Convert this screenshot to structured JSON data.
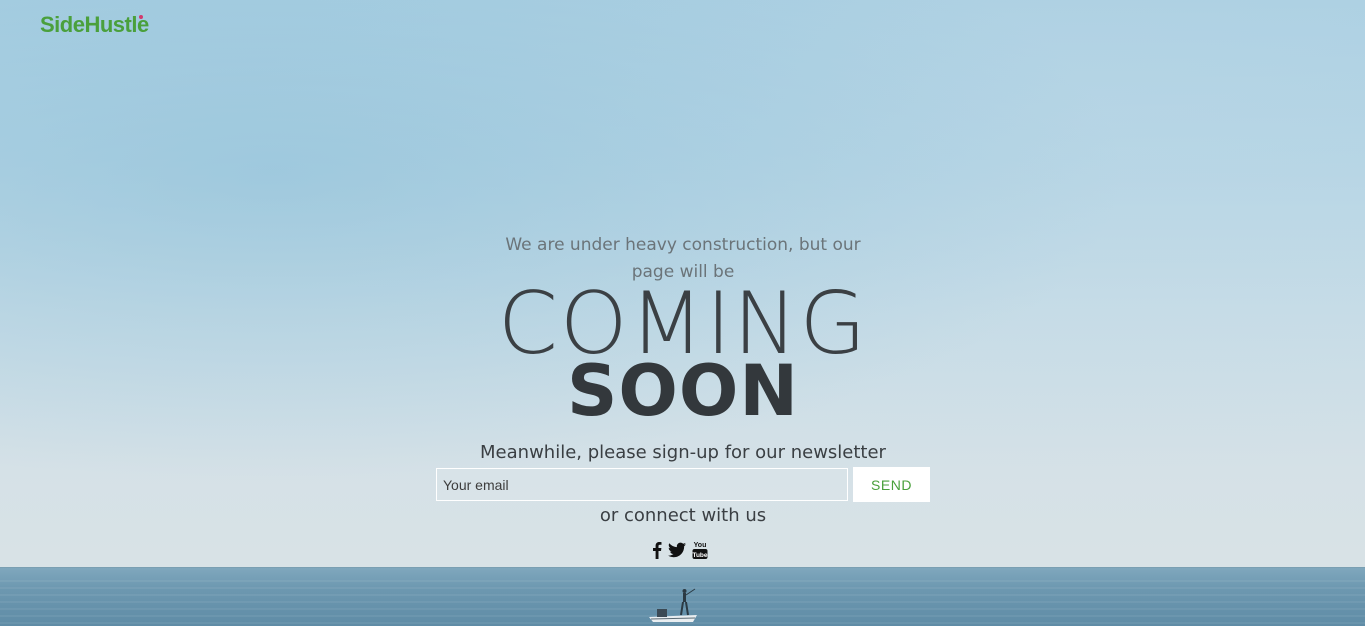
{
  "brand": {
    "logo_text": "SideHustle",
    "accent_color": "#4aa03c"
  },
  "hero": {
    "tagline": "We are under heavy construction, but our page will be",
    "headline_light": "COMING",
    "headline_bold": "SOON"
  },
  "newsletter": {
    "prompt": "Meanwhile, please sign-up for our newsletter",
    "email_placeholder": "Your email",
    "email_value": "",
    "send_label": "SEND"
  },
  "connect": {
    "prompt": "or connect with us",
    "icons": [
      "facebook-icon",
      "twitter-icon",
      "youtube-icon"
    ]
  }
}
